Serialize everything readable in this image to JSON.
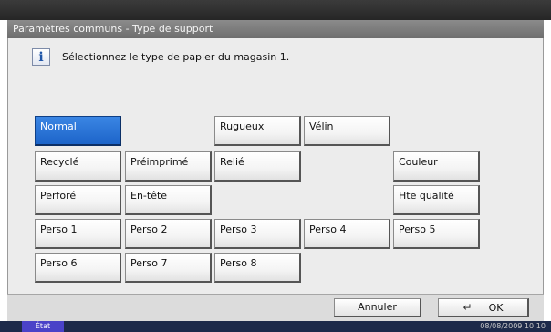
{
  "window": {
    "title": "Paramètres communs - Type de support"
  },
  "message": {
    "text": "Sélectionnez le type de papier du magasin 1.",
    "icon": "info-icon"
  },
  "paper_types": [
    {
      "label": "Normal",
      "selected": true
    },
    {
      "label": "Rugueux"
    },
    {
      "label": "Vélin"
    },
    {
      "label": "Recyclé"
    },
    {
      "label": "Préimprimé"
    },
    {
      "label": "Relié"
    },
    {
      "label": "Couleur"
    },
    {
      "label": "Perforé"
    },
    {
      "label": "En-tête"
    },
    {
      "label": "Hte qualité"
    },
    {
      "label": "Perso 1"
    },
    {
      "label": "Perso 2"
    },
    {
      "label": "Perso 3"
    },
    {
      "label": "Perso 4"
    },
    {
      "label": "Perso 5"
    },
    {
      "label": "Perso 6"
    },
    {
      "label": "Perso 7"
    },
    {
      "label": "Perso 8"
    }
  ],
  "actions": {
    "cancel": "Annuler",
    "ok": "OK",
    "ok_icon": "enter-key-icon"
  },
  "status": {
    "state": "État",
    "datetime": "08/08/2009   10:10"
  },
  "colors": {
    "selected": "#1c64c9",
    "titlebar": "#7a7a7a",
    "panel": "#ececec"
  }
}
